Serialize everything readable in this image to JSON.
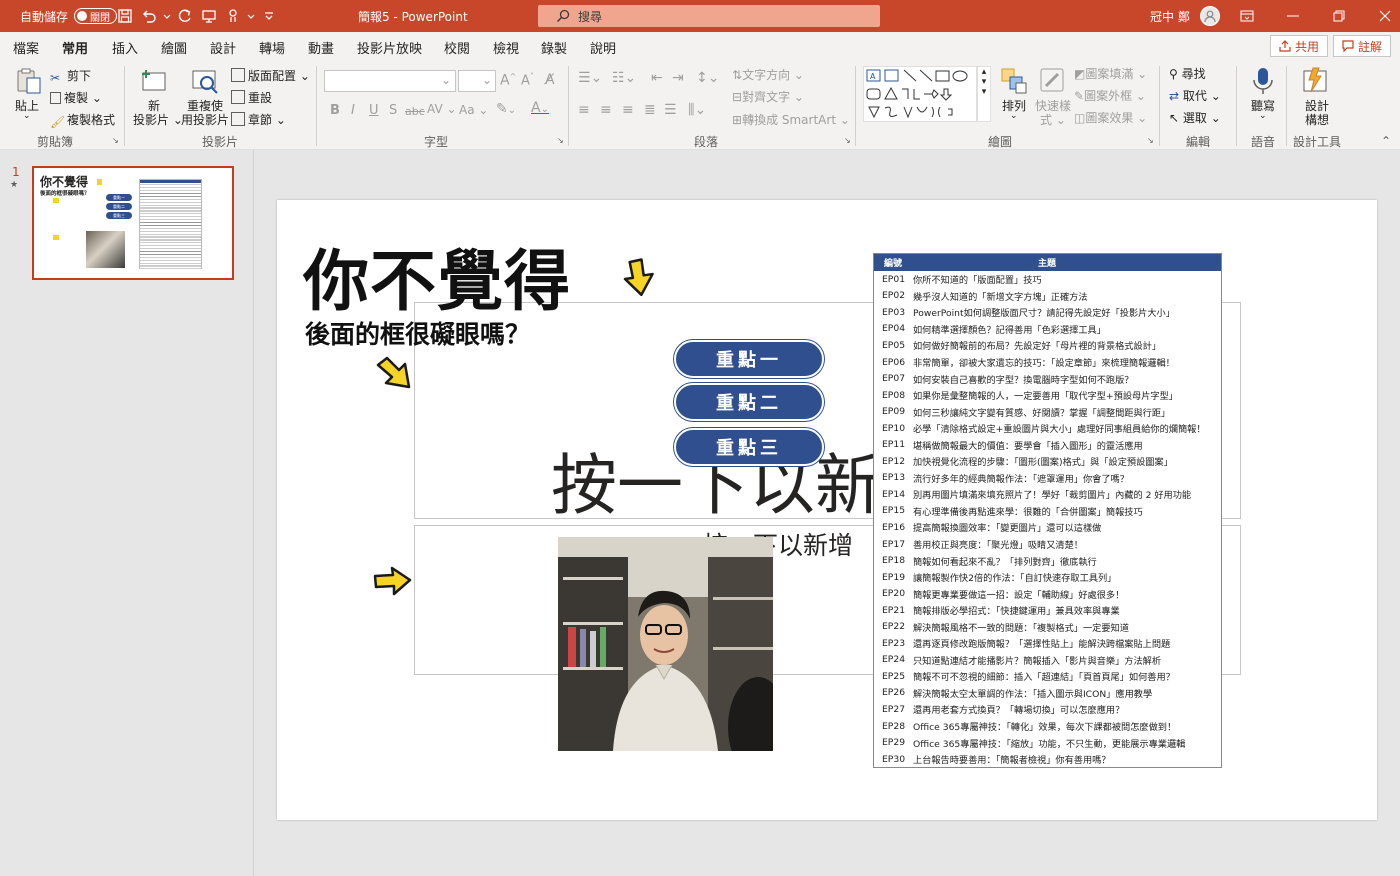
{
  "titlebar": {
    "autosave_label": "自動儲存",
    "autosave_state": "關閉",
    "doc_title": "簡報5  -  PowerPoint",
    "search_placeholder": "搜尋",
    "user_name": "冠中 鄭"
  },
  "tabs": [
    "檔案",
    "常用",
    "插入",
    "繪圖",
    "設計",
    "轉場",
    "動畫",
    "投影片放映",
    "校閱",
    "檢視",
    "錄製",
    "說明"
  ],
  "active_tab": "常用",
  "share_label": "共用",
  "comment_label": "註解",
  "ribbon": {
    "clipboard": {
      "paste": "貼上",
      "cut": "剪下",
      "copy": "複製",
      "format_painter": "複製格式",
      "group": "剪貼簿"
    },
    "slides": {
      "new_slide_l1": "新",
      "new_slide_l2": "投影片",
      "reuse_l1": "重複使",
      "reuse_l2": "用投影片",
      "layout": "版面配置",
      "reset": "重設",
      "section": "章節",
      "group": "投影片"
    },
    "font": {
      "group": "字型",
      "bold": "B",
      "italic": "I",
      "underline": "U",
      "strike": "S",
      "abc": "abc",
      "spacing": "AV",
      "case": "Aa"
    },
    "paragraph": {
      "text_direction": "文字方向",
      "align_text": "對齊文字",
      "smartart": "轉換成 SmartArt",
      "group": "段落"
    },
    "drawing": {
      "arrange": "排列",
      "quick_styles_l1": "快速樣",
      "quick_styles_l2": "式",
      "fill": "圖案填滿",
      "outline": "圖案外框",
      "effects": "圖案效果",
      "group": "繪圖"
    },
    "editing": {
      "find": "尋找",
      "replace": "取代",
      "select": "選取",
      "group": "編輯"
    },
    "voice": {
      "dictate": "聽寫",
      "group": "語音"
    },
    "designer": {
      "label_l1": "設計",
      "label_l2": "構想",
      "group": "設計工具"
    }
  },
  "thumbnail": {
    "number": "1",
    "star": "★",
    "title": "你不覺得",
    "subtitle": "後面的框很礙眼嗎？",
    "pill1": "重點一",
    "pill2": "重點二",
    "pill3": "重點三"
  },
  "slide": {
    "title": "你不覺得",
    "subtitle": "後面的框很礙眼嗎？",
    "placeholder_title": "按一下以新",
    "placeholder_sub": "按一下以新增",
    "pills": [
      "重點一",
      "重點二",
      "重點三"
    ],
    "table_header_ep": "編號",
    "table_header_topic": "主題",
    "episodes": [
      {
        "ep": "EP01",
        "topic": "你所不知道的「版面配置」技巧"
      },
      {
        "ep": "EP02",
        "topic": "幾乎沒人知道的「新增文字方塊」正確方法"
      },
      {
        "ep": "EP03",
        "topic": "PowerPoint如何調整版面尺寸？請記得先設定好「投影片大小」"
      },
      {
        "ep": "EP04",
        "topic": "如何精準選擇顏色？記得善用「色彩選擇工具」"
      },
      {
        "ep": "EP05",
        "topic": "如何做好簡報前的布局？先設定好「母片裡的背景格式設計」"
      },
      {
        "ep": "EP06",
        "topic": "非常簡單，卻被大家遺忘的技巧：「設定章節」來梳理簡報邏輯！"
      },
      {
        "ep": "EP07",
        "topic": "如何安裝自己喜歡的字型？換電腦時字型如何不跑版？"
      },
      {
        "ep": "EP08",
        "topic": "如果你是彙整簡報的人，一定要善用「取代字型+預設母片字型」"
      },
      {
        "ep": "EP09",
        "topic": "如何三秒讓純文字變有質感、好閱讀？掌握「調整間距與行距」"
      },
      {
        "ep": "EP10",
        "topic": "必學「清除格式設定+重設圖片與大小」處理好同事組員給你的爛簡報！"
      },
      {
        "ep": "EP11",
        "topic": "堪稱做簡報最大的價值：要學會「插入圖形」的靈活應用"
      },
      {
        "ep": "EP12",
        "topic": "加快視覺化流程的步驟：「圖形(圖案)格式」與「設定預設圖案」"
      },
      {
        "ep": "EP13",
        "topic": "流行好多年的經典簡報作法：「遮罩運用」你會了嗎？"
      },
      {
        "ep": "EP14",
        "topic": "別再用圖片填滿來填充照片了！學好「裁剪圖片」內藏的 2 好用功能"
      },
      {
        "ep": "EP15",
        "topic": "有心理準備後再點進來學：很難的「合併圖案」簡報技巧"
      },
      {
        "ep": "EP16",
        "topic": "提高簡報換圖效率：「變更圖片」還可以這樣做"
      },
      {
        "ep": "EP17",
        "topic": "善用校正與亮度：「聚光燈」吸睛又清楚！"
      },
      {
        "ep": "EP18",
        "topic": "簡報如何看起來不亂？「排列對齊」徹底執行"
      },
      {
        "ep": "EP19",
        "topic": "讓簡報製作快2倍的作法：「自訂快速存取工具列」"
      },
      {
        "ep": "EP20",
        "topic": "簡報更專業要做這一招：設定「輔助線」好處很多！"
      },
      {
        "ep": "EP21",
        "topic": "簡報排版必學招式：「快捷鍵運用」兼具效率與專業"
      },
      {
        "ep": "EP22",
        "topic": "解決簡報風格不一致的問題：「複製格式」一定要知道"
      },
      {
        "ep": "EP23",
        "topic": "還再逐頁修改跑版簡報？「選擇性貼上」能解決跨檔案貼上問題"
      },
      {
        "ep": "EP24",
        "topic": "只知道點連結才能播影片？簡報插入「影片與音樂」方法解析"
      },
      {
        "ep": "EP25",
        "topic": "簡報不可不忽視的細節：插入「超連結」「頁首頁尾」如何善用？"
      },
      {
        "ep": "EP26",
        "topic": "解決簡報太空太單調的作法：「插入圖示與ICON」應用教學"
      },
      {
        "ep": "EP27",
        "topic": "還再用老套方式換頁？「轉場切換」可以怎麼應用？"
      },
      {
        "ep": "EP28",
        "topic": "Office 365專屬神技：「轉化」效果，每次下課都被問怎麼做到！"
      },
      {
        "ep": "EP29",
        "topic": "Office 365專屬神技：「縮放」功能，不只生動，更能展示專業邏輯"
      },
      {
        "ep": "EP30",
        "topic": "上台報告時要善用：「簡報者檢視」你有善用嗎？"
      }
    ]
  },
  "colors": {
    "title_bar": "#c8472b",
    "accent_red": "#c43e1c",
    "pill_blue": "#2f4f8f",
    "arrow_yellow": "#f5d327"
  }
}
